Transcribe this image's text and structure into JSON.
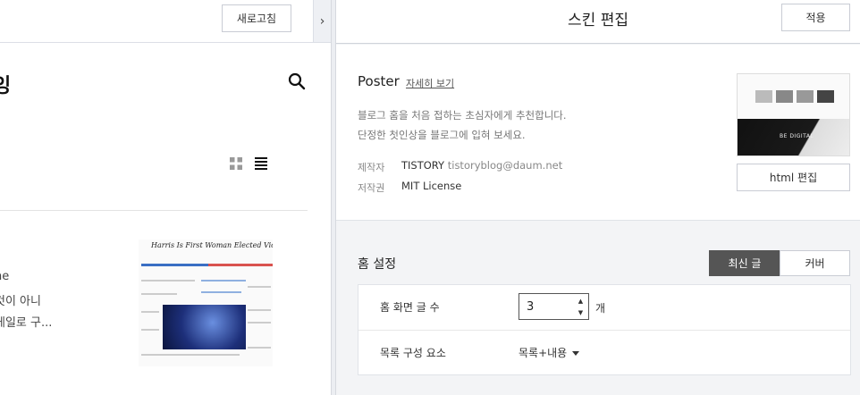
{
  "left_pane": {
    "refresh_label": "새로고침",
    "collapse_glyph": "›",
    "blog_title_partial": "잉",
    "post": {
      "excerpt_lines": [
        "ne",
        "것이 아니",
        "게일로 구..."
      ],
      "thumbnail_headline": "Harris Is First Woman Elected Vice President"
    }
  },
  "right_pane": {
    "title": "스킨 편집",
    "apply_label": "적용",
    "skin": {
      "name": "Poster",
      "detail_link": "자세히 보기",
      "description_lines": [
        "블로그 홈을 처음 접하는 초심자에게 추천합니다.",
        "단정한 첫인상을 블로그에 입혀 보세요."
      ],
      "author_label": "제작자",
      "author_name": "TISTORY",
      "author_email": "tistoryblog@daum.net",
      "license_label": "저작권",
      "license_value": "MIT License",
      "thumbnail_caption": "BE DIGITAL",
      "html_edit_label": "html 편집"
    },
    "home_settings": {
      "title": "홈 설정",
      "tabs": [
        {
          "label": "최신 글",
          "active": true
        },
        {
          "label": "커버",
          "active": false
        }
      ],
      "post_count_label": "홈 화면 글 수",
      "post_count_value": "3",
      "post_count_unit": "개",
      "list_component_label": "목록 구성 요소",
      "list_component_value": "목록+내용"
    }
  },
  "colors": {
    "active_tab_bg": "#555555",
    "border": "#c9ccd4",
    "panel_bg": "#f3f4f6"
  }
}
